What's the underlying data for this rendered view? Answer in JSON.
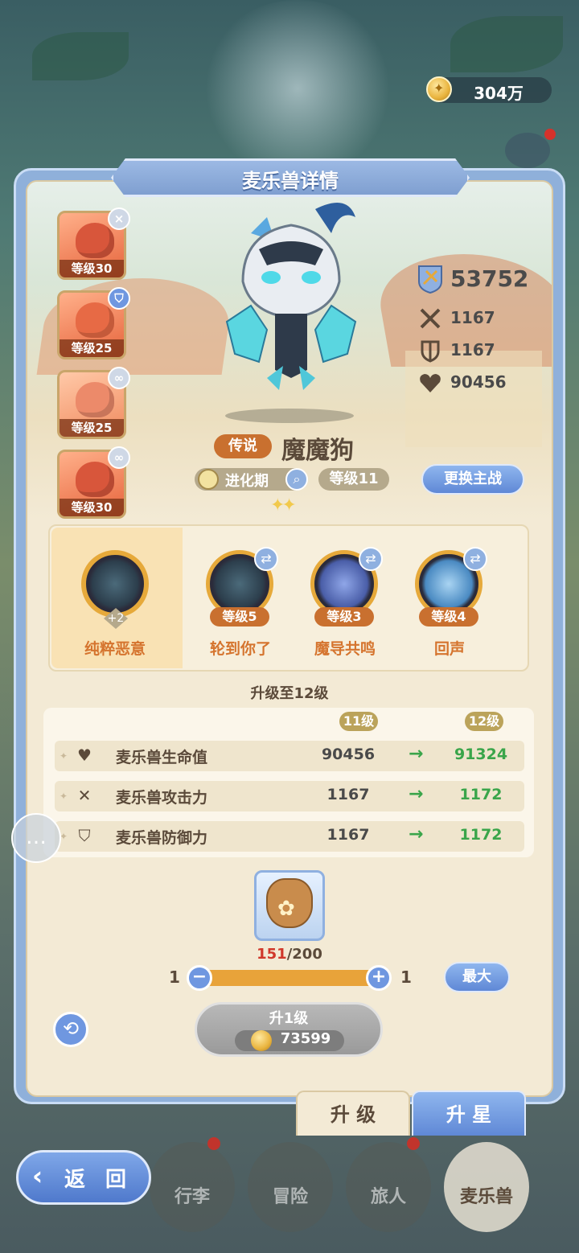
{
  "currency": {
    "coins": "304万",
    "coin_icon": "gold-coin-icon"
  },
  "panel": {
    "title": "麦乐兽详情"
  },
  "pet_list": [
    {
      "level": "等级30",
      "badge": "×",
      "badge_icon": "close-icon",
      "badge_color": "#cfd8e6"
    },
    {
      "level": "等级25",
      "badge": "⛉",
      "badge_icon": "shield-icon",
      "badge_color": "#6f97e0"
    },
    {
      "level": "等级25",
      "badge": "∞",
      "badge_icon": "link-icon",
      "badge_color": "#cfd8e6"
    },
    {
      "level": "等级30",
      "badge": "∞",
      "badge_icon": "link-icon",
      "badge_color": "#cfd8e6"
    }
  ],
  "stats": {
    "power": "53752",
    "attack": "1167",
    "defense": "1167",
    "hp": "90456"
  },
  "pet": {
    "rarity": "传说",
    "name": "魔魔狗",
    "stage": "进化期",
    "level": "等级11",
    "stars": "✦✦"
  },
  "switch_button": "更换主战",
  "skills": [
    {
      "name": "纯粹恶意",
      "badge": "+2"
    },
    {
      "name": "轮到你了",
      "level": "等级5"
    },
    {
      "name": "魔导共鸣",
      "level": "等级3"
    },
    {
      "name": "回声",
      "level": "等级4"
    }
  ],
  "upgrade": {
    "title": "升级至12级",
    "from_level": "11级",
    "to_level": "12级",
    "rows": [
      {
        "label": "麦乐兽生命值",
        "from": "90456",
        "to": "91324",
        "icon": "heart-icon"
      },
      {
        "label": "麦乐兽攻击力",
        "from": "1167",
        "to": "1172",
        "icon": "swords-icon"
      },
      {
        "label": "麦乐兽防御力",
        "from": "1167",
        "to": "1172",
        "icon": "shield-icon"
      }
    ]
  },
  "material": {
    "have": "151",
    "need": "/200",
    "icon": "food-bag-icon"
  },
  "slider": {
    "min": "1",
    "max": "1",
    "value_fraction": 1.0,
    "minus": "−",
    "plus": "+"
  },
  "max_button": "最大",
  "upgrade_button": {
    "label": "升1级",
    "cost": "73599"
  },
  "tabs": [
    {
      "label": "升 级"
    },
    {
      "label": "升 星"
    }
  ],
  "back_button": "返 回",
  "nav": [
    {
      "label": "行李",
      "has_dot": true
    },
    {
      "label": "冒险",
      "has_dot": false
    },
    {
      "label": "旅人",
      "has_dot": true
    },
    {
      "label": "麦乐兽",
      "has_dot": false,
      "active": true
    }
  ],
  "colors": {
    "accent_blue": "#5f88d6",
    "panel_bg": "#f3ead5",
    "stat_up_green": "#3aa54a",
    "skill_name": "#d5742e",
    "rarity": "#c9702f"
  }
}
